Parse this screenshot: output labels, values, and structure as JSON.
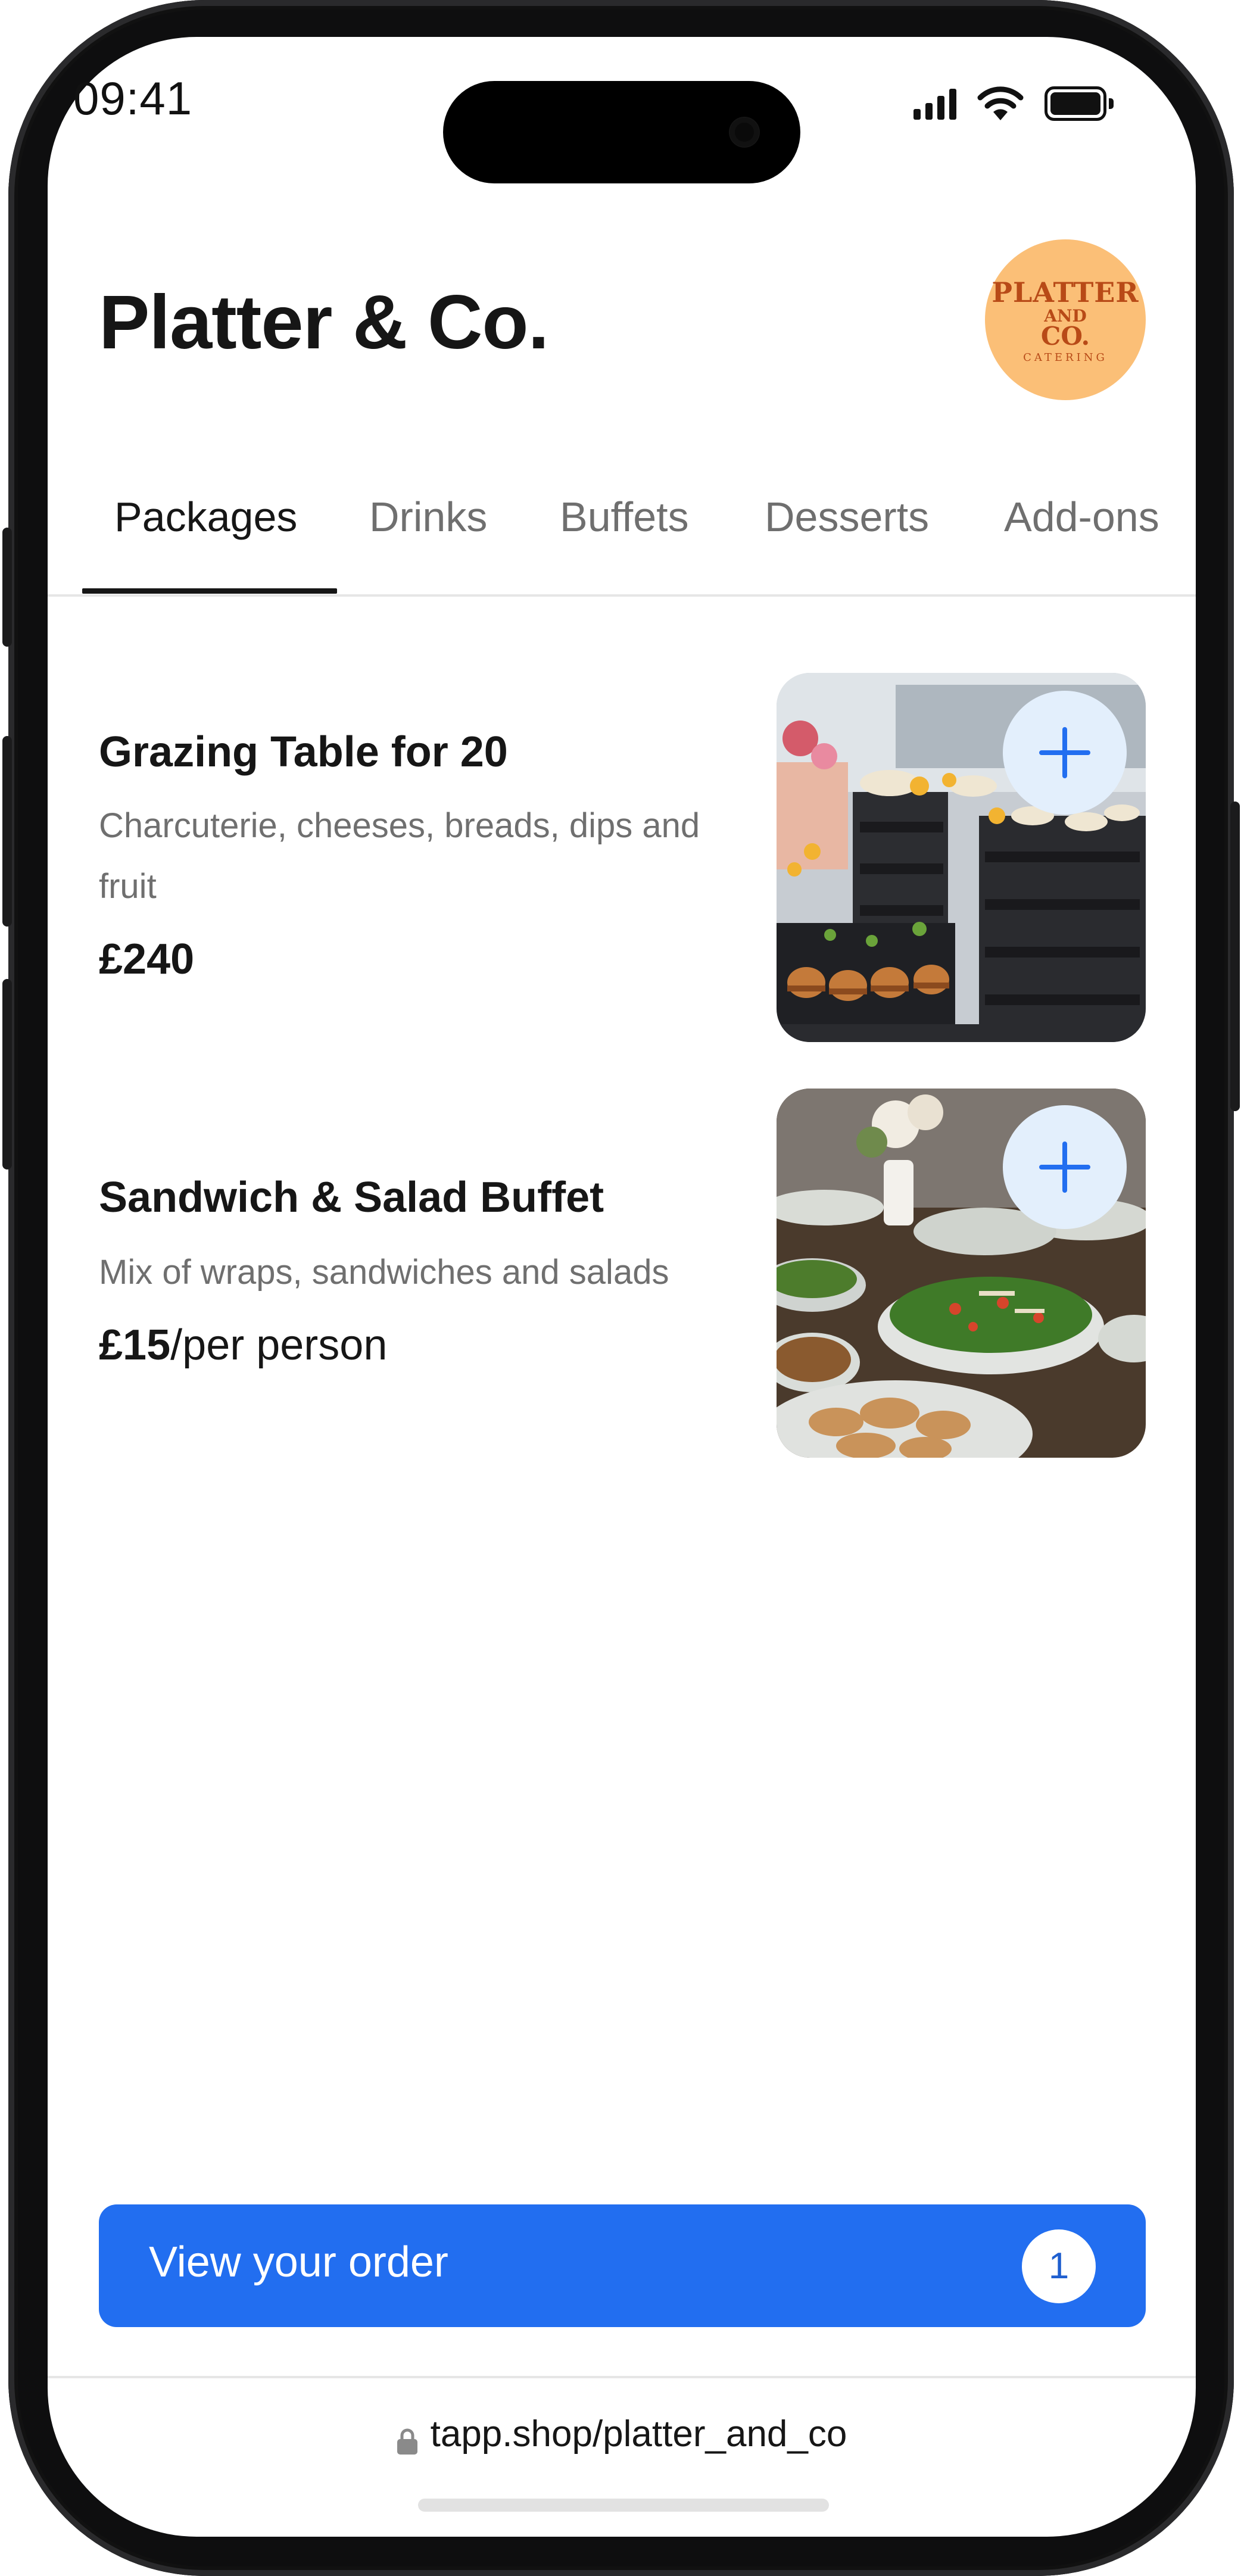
{
  "status_bar": {
    "time": "09:41"
  },
  "header": {
    "title": "Platter & Co.",
    "logo": {
      "line1": "PLATTER",
      "line2": "AND",
      "line3": "CO.",
      "line4": "CATERING"
    }
  },
  "tabs": [
    {
      "label": "Packages",
      "active": true
    },
    {
      "label": "Drinks",
      "active": false
    },
    {
      "label": "Buffets",
      "active": false
    },
    {
      "label": "Desserts",
      "active": false
    },
    {
      "label": "Add-ons",
      "active": false
    }
  ],
  "products": [
    {
      "title": "Grazing Table for 20",
      "description": "Charcuterie, cheeses, breads, dips and fruit",
      "price": "£240",
      "price_suffix": ""
    },
    {
      "title": "Sandwich & Salad Buffet",
      "description": "Mix of wraps, sandwiches and salads",
      "price": "£15",
      "price_suffix": "/per person"
    }
  ],
  "order_button": {
    "label": "View your order",
    "count": "1"
  },
  "url_bar": {
    "url": "tapp.shop/platter_and_co"
  },
  "colors": {
    "accent": "#226ef0",
    "add_button_bg": "#e3effc",
    "logo_bg": "#fbbf77",
    "logo_text": "#b84a17"
  }
}
